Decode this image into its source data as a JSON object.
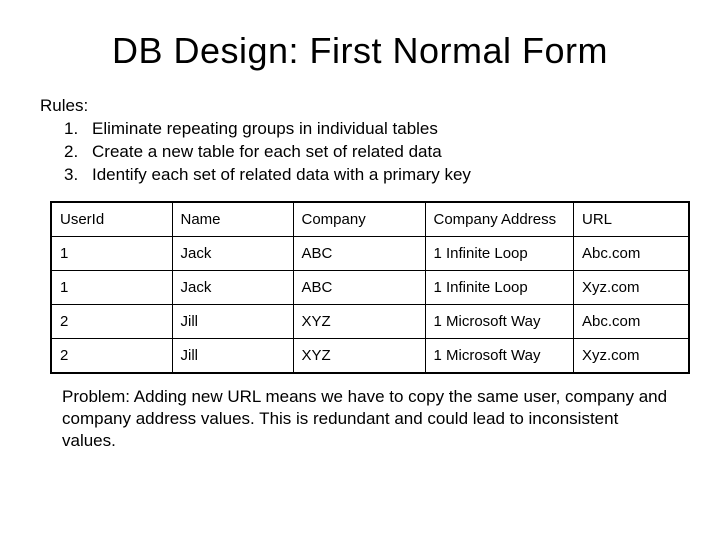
{
  "title": "DB Design: First Normal Form",
  "rules_label": "Rules:",
  "rules": [
    {
      "n": "1.",
      "text": "Eliminate repeating groups in individual tables"
    },
    {
      "n": "2.",
      "text": "Create a new table for each set of related data"
    },
    {
      "n": "3.",
      "text": "Identify each set of related data with a primary key"
    }
  ],
  "table": {
    "headers": [
      "UserId",
      "Name",
      "Company",
      "Company Address",
      "URL"
    ],
    "rows": [
      [
        "1",
        "Jack",
        "ABC",
        "1 Infinite Loop",
        "Abc.com"
      ],
      [
        "1",
        "Jack",
        "ABC",
        "1 Infinite Loop",
        "Xyz.com"
      ],
      [
        "2",
        "Jill",
        "XYZ",
        "1 Microsoft Way",
        "Abc.com"
      ],
      [
        "2",
        "Jill",
        "XYZ",
        "1 Microsoft Way",
        "Xyz.com"
      ]
    ]
  },
  "problem": "Problem: Adding new URL means we have to copy the same user, company and company address values. This is redundant and could lead to inconsistent values."
}
